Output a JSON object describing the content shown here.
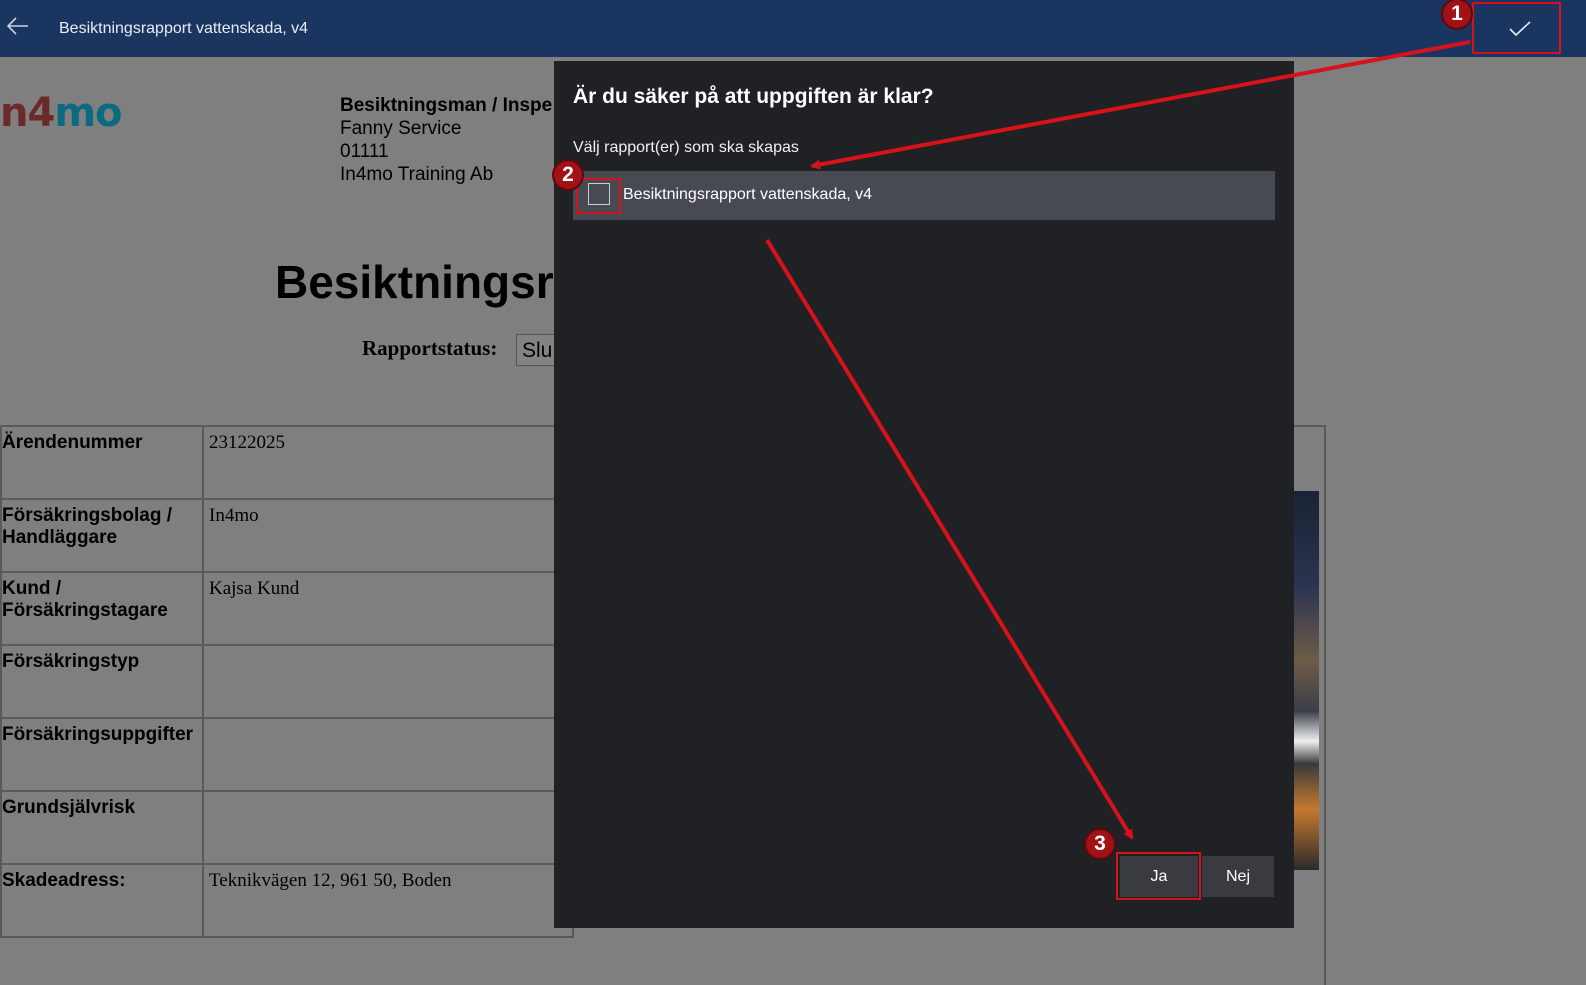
{
  "topbar": {
    "title": "Besiktningsrapport vattenskada, v4",
    "back_icon": "arrow-left-icon",
    "confirm_icon": "checkmark-icon"
  },
  "document": {
    "logo": {
      "part1": "n4",
      "part2": "mo"
    },
    "inspector": {
      "heading": "Besiktningsman / Inspe",
      "name": "Fanny Service",
      "number": "01111",
      "company": "In4mo Training Ab"
    },
    "title": "Besiktningsr",
    "status_label": "Rapportstatus:",
    "status_value": "Slu",
    "rows": [
      {
        "label": "Ärendenummer",
        "value": "23122025"
      },
      {
        "label": "Försäkringsbolag / Handläggare",
        "value": "In4mo"
      },
      {
        "label": "Kund / Försäkringstagare",
        "value": "Kajsa Kund"
      },
      {
        "label": "Försäkringstyp",
        "value": ""
      },
      {
        "label": "Försäkringsuppgifter",
        "value": ""
      },
      {
        "label": "Grundsjälvrisk",
        "value": ""
      },
      {
        "label": "Skadeadress:",
        "value": "Teknikvägen 12, 961 50, Boden"
      }
    ]
  },
  "dialog": {
    "title": "Är du säker på att uppgiften är klar?",
    "subtitle": "Välj rapport(er) som ska skapas",
    "report_item_label": "Besiktningsrapport vattenskada, v4",
    "report_checked": false,
    "yes_label": "Ja",
    "no_label": "Nej"
  },
  "annotations": {
    "badges": [
      "1",
      "2",
      "3"
    ],
    "color": "#d8121b"
  },
  "colors": {
    "topbar": "#1a3660",
    "dialog": "#202124",
    "selected_item": "#474953",
    "highlight": "#d8121b"
  }
}
